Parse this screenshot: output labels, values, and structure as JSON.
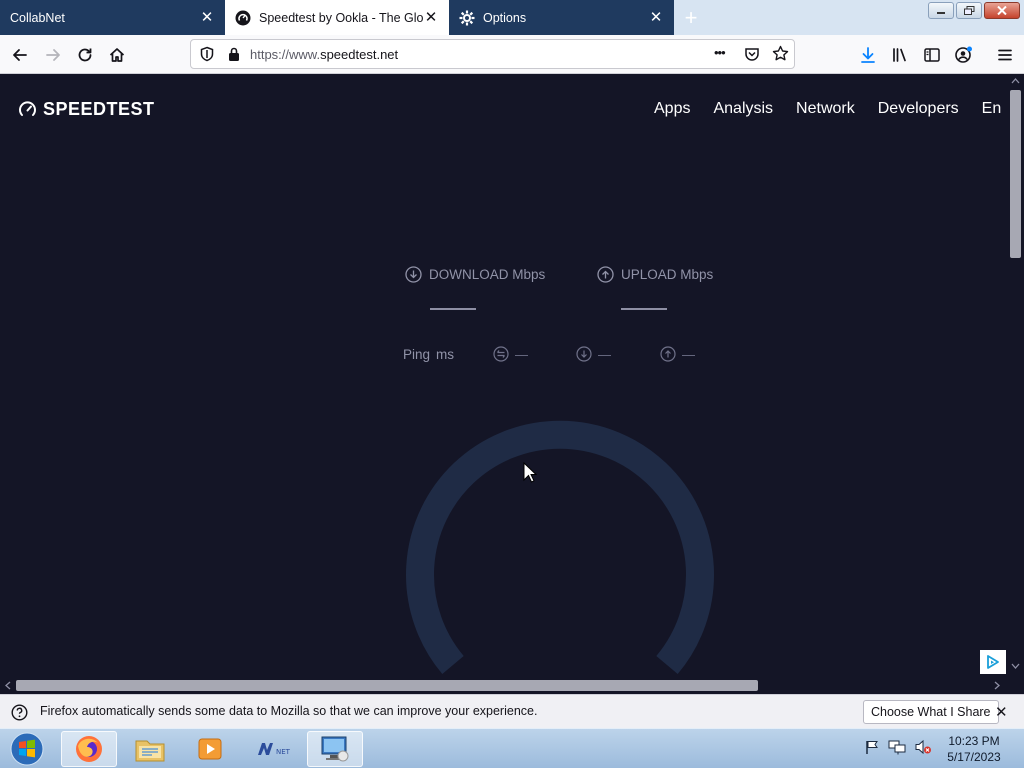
{
  "browser": {
    "tabs": [
      {
        "title": "CollabNet",
        "active": false
      },
      {
        "title": "Speedtest by Ookla - The Glob",
        "active": true
      },
      {
        "title": "Options",
        "active": false
      }
    ],
    "new_tab_label": "+",
    "close_glyph": "✕",
    "url_prefix": "https://www.",
    "url_domain": "speedtest.net",
    "page_actions_glyph": "•••"
  },
  "site": {
    "logo_text": "SPEEDTEST",
    "nav": [
      "Apps",
      "Analysis",
      "Network",
      "Developers",
      "En"
    ],
    "download_label": "DOWNLOAD Mbps",
    "upload_label": "UPLOAD Mbps",
    "ping_label": "Ping",
    "ping_unit": "ms",
    "ping_values": {
      "jitter": "—",
      "down": "—",
      "up": "—"
    }
  },
  "notification": {
    "message": "Firefox automatically sends some data to Mozilla so that we can improve your experience.",
    "button_label": "Choose What I Share",
    "close_glyph": "✕"
  },
  "taskbar": {
    "time": "10:23 PM",
    "date": "5/17/2023",
    "apps": [
      "firefox-icon",
      "file-explorer-icon",
      "media-player-icon",
      "dotnet-icon",
      "remote-desktop-icon"
    ]
  },
  "colors": {
    "page_bg": "#141526",
    "gauge": "#1f2b45",
    "tab_inactive": "#1f3a5f",
    "accent_download": "#0a84ff"
  }
}
